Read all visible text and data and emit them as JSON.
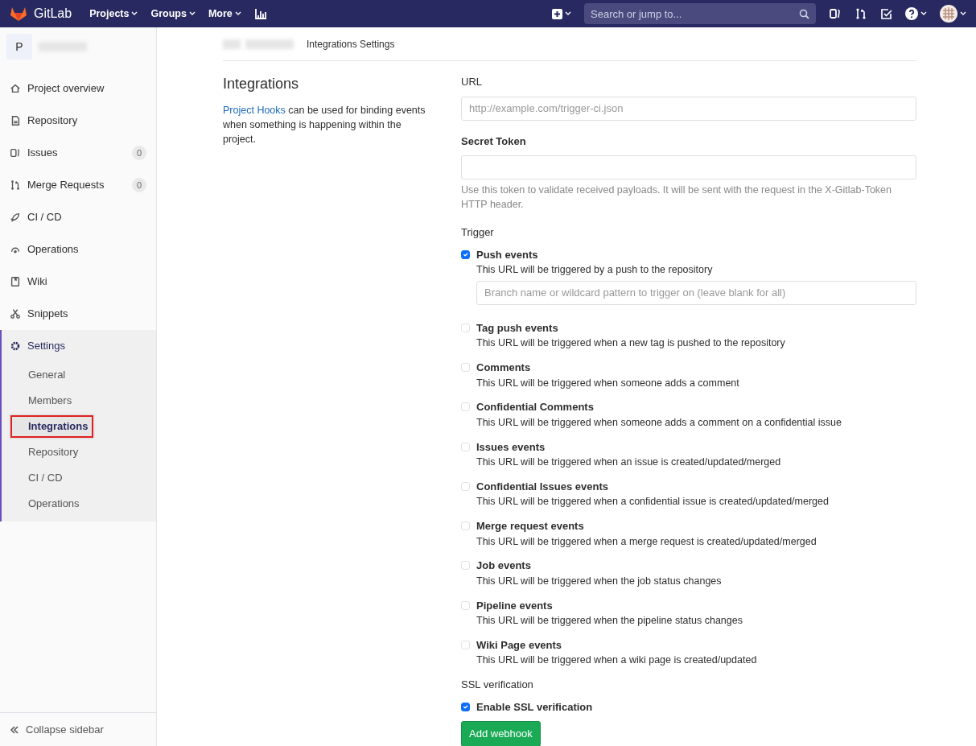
{
  "navbar": {
    "brand": "GitLab",
    "menus": [
      {
        "label": "Projects"
      },
      {
        "label": "Groups"
      },
      {
        "label": "More"
      }
    ],
    "search": {
      "placeholder": "Search or jump to..."
    }
  },
  "sidebar": {
    "project_letter": "P",
    "items": [
      {
        "label": "Project overview",
        "selected": false
      },
      {
        "label": "Repository",
        "selected": false
      },
      {
        "label": "Issues",
        "count": "0",
        "selected": false
      },
      {
        "label": "Merge Requests",
        "count": "0",
        "selected": false
      },
      {
        "label": "CI / CD",
        "selected": false
      },
      {
        "label": "Operations",
        "selected": false
      },
      {
        "label": "Wiki",
        "selected": false
      },
      {
        "label": "Snippets",
        "selected": false
      },
      {
        "label": "Settings",
        "selected": true,
        "children": [
          {
            "label": "General",
            "selected": false,
            "highlighted": false
          },
          {
            "label": "Members",
            "selected": false,
            "highlighted": false
          },
          {
            "label": "Integrations",
            "selected": true,
            "highlighted": true
          },
          {
            "label": "Repository",
            "selected": false,
            "highlighted": false
          },
          {
            "label": "CI / CD",
            "selected": false,
            "highlighted": false
          },
          {
            "label": "Operations",
            "selected": false,
            "highlighted": false
          }
        ]
      }
    ],
    "collapse": "Collapse sidebar"
  },
  "breadcrumb": {
    "current": "Integrations Settings"
  },
  "intro": {
    "title": "Integrations",
    "link": "Project Hooks",
    "text": " can be used for binding events when something is happening within the project."
  },
  "form": {
    "url": {
      "label": "URL",
      "placeholder": "http://example.com/trigger-ci.json"
    },
    "token": {
      "label": "Secret Token",
      "help": "Use this token to validate received payloads. It will be sent with the request in the X-Gitlab-Token HTTP header."
    },
    "trigger_label": "Trigger",
    "triggers": [
      {
        "label": "Push events",
        "help": "This URL will be triggered by a push to the repository",
        "checked": true,
        "filter": {
          "placeholder": "Branch name or wildcard pattern to trigger on (leave blank for all)"
        }
      },
      {
        "label": "Tag push events",
        "help": "This URL will be triggered when a new tag is pushed to the repository",
        "checked": false
      },
      {
        "label": "Comments",
        "help": "This URL will be triggered when someone adds a comment",
        "checked": false
      },
      {
        "label": "Confidential Comments",
        "help": "This URL will be triggered when someone adds a comment on a confidential issue",
        "checked": false
      },
      {
        "label": "Issues events",
        "help": "This URL will be triggered when an issue is created/updated/merged",
        "checked": false
      },
      {
        "label": "Confidential Issues events",
        "help": "This URL will be triggered when a confidential issue is created/updated/merged",
        "checked": false
      },
      {
        "label": "Merge request events",
        "help": "This URL will be triggered when a merge request is created/updated/merged",
        "checked": false
      },
      {
        "label": "Job events",
        "help": "This URL will be triggered when the job status changes",
        "checked": false
      },
      {
        "label": "Pipeline events",
        "help": "This URL will be triggered when the pipeline status changes",
        "checked": false
      },
      {
        "label": "Wiki Page events",
        "help": "This URL will be triggered when a wiki page is created/updated",
        "checked": false
      }
    ],
    "ssl_label": "SSL verification",
    "ssl": {
      "label": "Enable SSL verification",
      "checked": true
    },
    "submit": "Add webhook"
  }
}
